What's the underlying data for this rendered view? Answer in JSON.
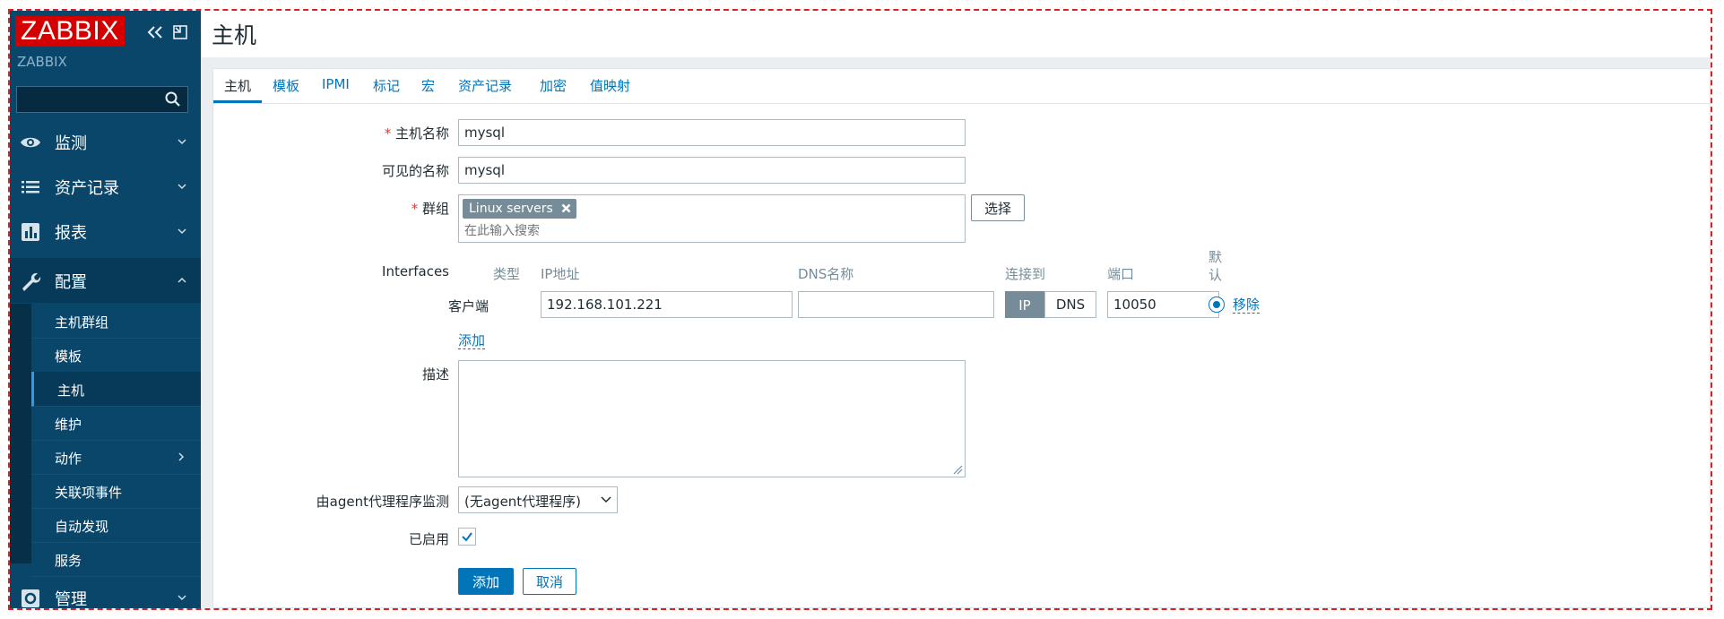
{
  "sidebar": {
    "logo": "ZABBIX",
    "server_name": "ZABBIX",
    "search_placeholder": "",
    "sections": [
      {
        "label": "监测",
        "icon": "eye-icon"
      },
      {
        "label": "资产记录",
        "icon": "list-icon"
      },
      {
        "label": "报表",
        "icon": "bar-chart-icon"
      },
      {
        "label": "配置",
        "icon": "wrench-icon"
      },
      {
        "label": "管理",
        "icon": "gear-icon"
      }
    ],
    "config_items": [
      {
        "label": "主机群组"
      },
      {
        "label": "模板"
      },
      {
        "label": "主机"
      },
      {
        "label": "维护"
      },
      {
        "label": "动作"
      },
      {
        "label": "关联项事件"
      },
      {
        "label": "自动发现"
      },
      {
        "label": "服务"
      }
    ],
    "active_section": "配置",
    "selected_item": "主机"
  },
  "page": {
    "title": "主机"
  },
  "tabs": [
    "主机",
    "模板",
    "IPMI",
    "标记",
    "宏",
    "资产记录",
    "加密",
    "值映射"
  ],
  "active_tab": "主机",
  "form": {
    "host_name_label": "主机名称",
    "host_name_value": "mysql",
    "visible_name_label": "可见的名称",
    "visible_name_value": "mysql",
    "groups_label": "群组",
    "group_chip": "Linux servers",
    "groups_placeholder": "在此输入搜索",
    "select_button": "选择",
    "interfaces_label": "Interfaces",
    "interface_headers": {
      "type": "类型",
      "ip": "IP地址",
      "dns": "DNS名称",
      "connect_to": "连接到",
      "port": "端口",
      "default": "默认"
    },
    "interface": {
      "type": "客户端",
      "ip": "192.168.101.221",
      "dns": "",
      "connect_ip": "IP",
      "connect_dns": "DNS",
      "connect_selected": "IP",
      "port": "10050",
      "is_default": true,
      "remove_link": "移除"
    },
    "add_interface_link": "添加",
    "description_label": "描述",
    "description_value": "",
    "proxy_label": "由agent代理程序监测",
    "proxy_value": "(无agent代理程序)",
    "enabled_label": "已启用",
    "enabled": true,
    "add_button": "添加",
    "cancel_button": "取消"
  },
  "colors": {
    "sidebar_bg": "#0a466a",
    "logo_bg": "#d40000",
    "accent": "#0275b8",
    "required": "#e33734"
  }
}
